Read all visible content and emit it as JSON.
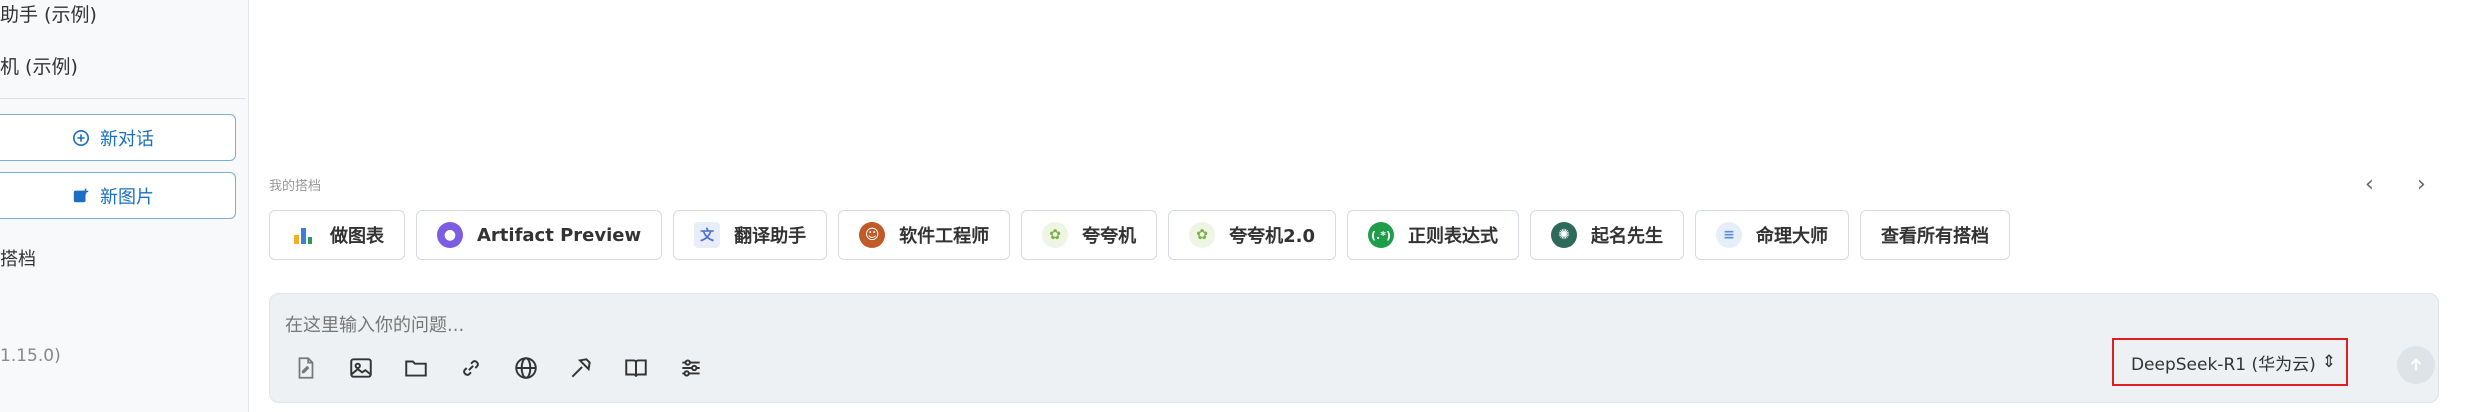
{
  "sidebar": {
    "items": [
      {
        "label": "助手 (示例)"
      },
      {
        "label": "机 (示例)"
      }
    ],
    "new_chat_label": "新对话",
    "new_image_label": "新图片",
    "section_label": "搭档",
    "version": "1.15.0)"
  },
  "main": {
    "section_title": "我的搭档",
    "prev_arrow": "‹",
    "next_arrow": "›",
    "chips": [
      {
        "label": "做图表",
        "icon": "chart-icon",
        "color": "#3b7dd8"
      },
      {
        "label": "Artifact Preview",
        "icon": "artifact-icon",
        "color": "#7c5ce0"
      },
      {
        "label": "翻译助手",
        "icon": "translate-icon",
        "color": "#4a6fd1"
      },
      {
        "label": "软件工程师",
        "icon": "engineer-icon",
        "color": "#c05a28"
      },
      {
        "label": "夸夸机",
        "icon": "praise-icon",
        "color": "#7db04a"
      },
      {
        "label": "夸夸机2.0",
        "icon": "praise2-icon",
        "color": "#7db04a"
      },
      {
        "label": "正则表达式",
        "icon": "regex-icon",
        "color": "#1e9e4a"
      },
      {
        "label": "起名先生",
        "icon": "naming-icon",
        "color": "#2e6a5a"
      },
      {
        "label": "命理大师",
        "icon": "fortune-icon",
        "color": "#5a8fd8"
      },
      {
        "label": "查看所有搭档",
        "icon": "",
        "color": ""
      }
    ],
    "input": {
      "placeholder": "在这里输入你的问题..."
    },
    "model_selector": "DeepSeek-R1 (华为云)",
    "model_arrow": "⇕"
  }
}
